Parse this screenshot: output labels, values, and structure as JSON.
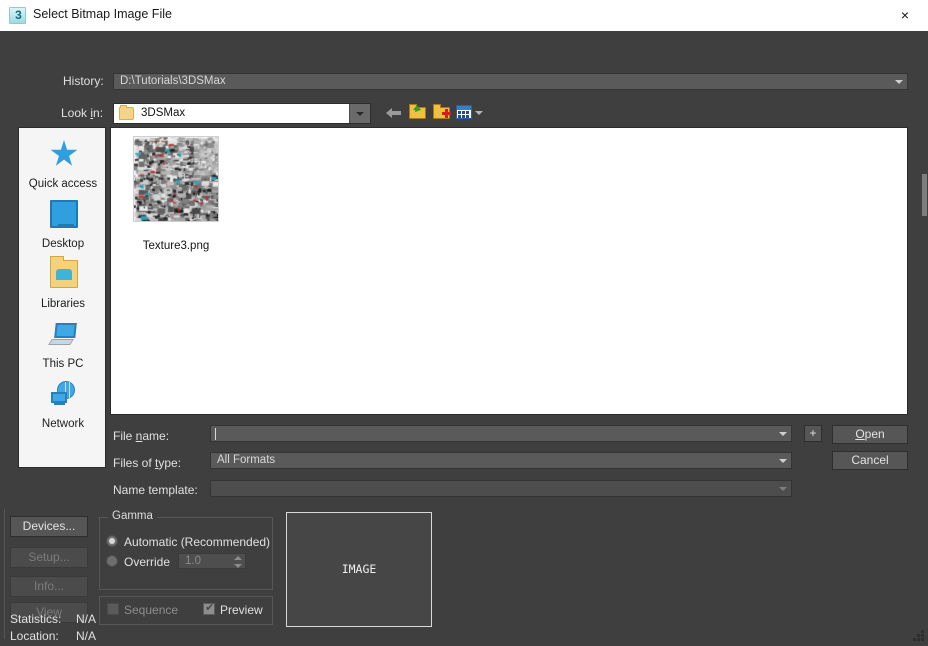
{
  "window": {
    "title": "Select Bitmap Image File",
    "app_icon": "3ds-max-icon",
    "app_icon_glyph": "3",
    "close_label": "×"
  },
  "toolbar": {
    "history_label": "History:",
    "history_value": "D:\\Tutorials\\3DSMax",
    "lookin_label_pre": "Look ",
    "lookin_label_accel": "i",
    "lookin_label_post": "n:",
    "lookin_value": "3DSMax",
    "buttons": [
      {
        "name": "back-icon",
        "tip": "Back"
      },
      {
        "name": "up-one-level-icon",
        "tip": "Up One Level"
      },
      {
        "name": "create-new-folder-icon",
        "tip": "Create New Folder"
      },
      {
        "name": "views-icon",
        "tip": "Views"
      }
    ]
  },
  "places": [
    {
      "label": "Quick access",
      "icon": "quick-access-star-icon"
    },
    {
      "label": "Desktop",
      "icon": "desktop-monitor-icon"
    },
    {
      "label": "Libraries",
      "icon": "libraries-folder-icon"
    },
    {
      "label": "This PC",
      "icon": "this-pc-computer-icon"
    },
    {
      "label": "Network",
      "icon": "network-globe-icon"
    }
  ],
  "files": [
    {
      "name": "Texture3.png",
      "thumbnail": "texture-map-thumbnail"
    }
  ],
  "form": {
    "filename_label_pre": "File ",
    "filename_label_accel": "n",
    "filename_label_post": "ame:",
    "filename_value": "",
    "filetype_label_pre": "Files of ",
    "filetype_label_accel": "t",
    "filetype_label_post": "ype:",
    "filetype_value": "All Formats",
    "nametemplate_label": "Name template:",
    "nametemplate_value": "",
    "plus_button": "+",
    "open_button_accel": "O",
    "open_button_rest": "pen",
    "cancel_button": "Cancel"
  },
  "side_buttons": [
    {
      "label": "Devices...",
      "enabled": true
    },
    {
      "label": "Setup...",
      "enabled": false
    },
    {
      "label": "Info...",
      "enabled": false
    },
    {
      "label": "View",
      "enabled": false
    }
  ],
  "gamma": {
    "group_title": "Gamma",
    "automatic_label": "Automatic (Recommended)",
    "automatic_selected": true,
    "override_label": "Override",
    "override_selected": false,
    "override_value": "1.0"
  },
  "options": {
    "sequence_label": "Sequence",
    "sequence_checked": false,
    "sequence_enabled": false,
    "preview_label": "Preview",
    "preview_checked": true
  },
  "preview": {
    "placeholder_text": "IMAGE"
  },
  "status": {
    "statistics_label": "Statistics:",
    "statistics_value": "N/A",
    "location_label": "Location:",
    "location_value": "N/A"
  },
  "colors": {
    "dialog_bg": "#3f3f3f",
    "field_bg": "#5a5a5a",
    "list_bg": "#ffffff",
    "title_bg": "#ffffff",
    "text": "#e0e0e0",
    "accent_blue": "#2f9fe0",
    "folder_yellow": "#f0c040"
  }
}
